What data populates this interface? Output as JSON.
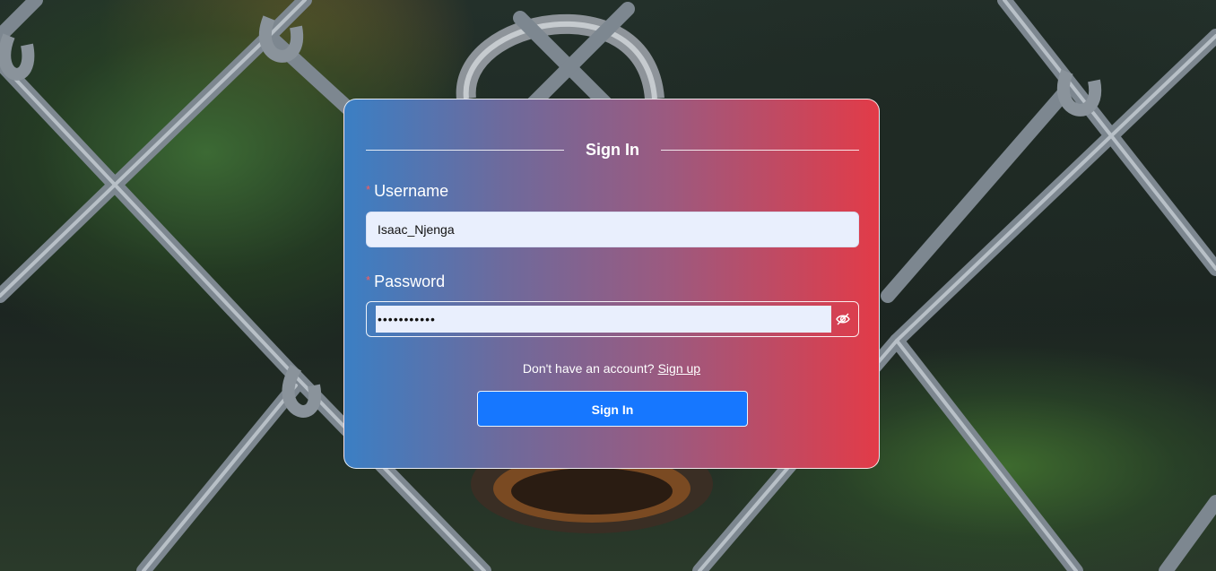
{
  "form": {
    "title": "Sign In",
    "username_label": "Username",
    "username_value": "Isaac_Njenga",
    "password_label": "Password",
    "password_value": "•••••••••••",
    "required_marker": "*",
    "signup_prompt": "Don't have an account?",
    "signup_link": "Sign up",
    "submit_label": "Sign In"
  },
  "icons": {
    "password_toggle": "eye-slash-icon"
  },
  "colors": {
    "submit_button": "#1677ff",
    "card_gradient_start": "#3b7fc4",
    "card_gradient_end": "#e23b48",
    "input_background": "#e9effd"
  }
}
